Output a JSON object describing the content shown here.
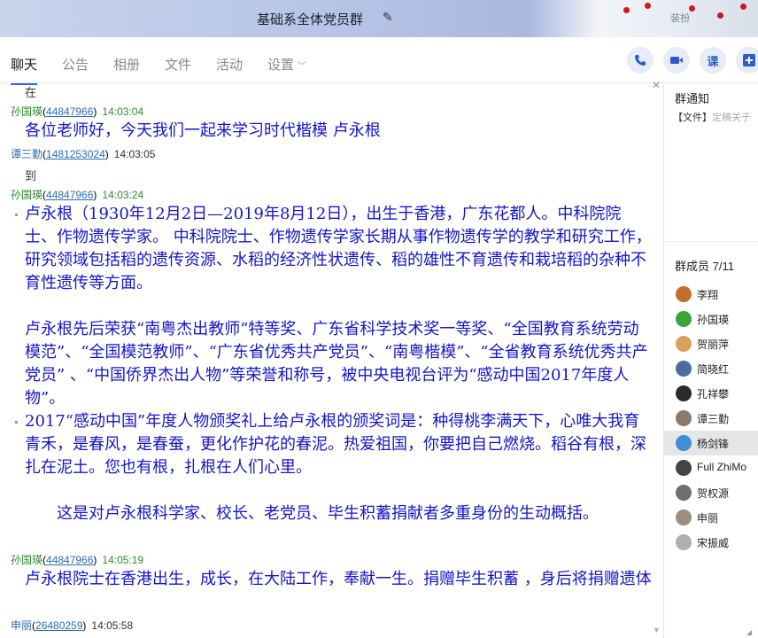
{
  "window": {
    "title": "基础系全体党员群",
    "settings_hint": "装扮"
  },
  "tabs": [
    "聊天",
    "公告",
    "相册",
    "文件",
    "活动",
    "设置"
  ],
  "toolbar": {
    "phone_icon": "phone-icon",
    "video_icon": "video-icon",
    "class_label": "课",
    "more_icon": "plus-icon"
  },
  "chat": {
    "messages": [
      {
        "text": "在"
      },
      {
        "name": "孙国瑛",
        "id": "44847966",
        "time": "14:03:04"
      },
      {
        "text": "各位老师好，今天我们一起来学习时代楷模 卢永根"
      },
      {
        "name": "谭三勤",
        "id": "1481253024",
        "time": "14:03:05"
      },
      {
        "text": "到"
      },
      {
        "name": "孙国瑛",
        "id": "44847966",
        "time": "14:03:24"
      },
      {
        "text": "卢永根（1930年12月2日—2019年8月12日），出生于香港，广东花都人。中科院院士、作物遗传学家。 中科院院士、作物遗传学家长期从事作物遗传学的教学和研究工作，研究领域包括稻的遗传资源、水稻的经济性状遗传、稻的雄性不育遗传和栽培稻的杂种不育性遗传等方面。"
      },
      {
        "text": "卢永根先后荣获“南粤杰出教师”特等奖、广东省科学技术奖一等奖、“全国教育系统劳动模范”、“全国模范教师”、“广东省优秀共产党员”、“南粤楷模”、“全省教育系统优秀共产党员” 、“中国侨界杰出人物”等荣誉和称号，被中央电视台评为“感动中国2017年度人物”。"
      },
      {
        "text": "2017“感动中国”年度人物颁奖礼上给卢永根的颁奖词是：种得桃李满天下，心唯大我育青禾，是春风，是春蚕，更化作护花的春泥。热爱祖国，你要把自己燃烧。稻谷有根，深扎在泥土。您也有根，扎根在人们心里。"
      },
      {
        "text": "这是对卢永根科学家、校长、老党员、毕生积蓄捐献者多重身份的生动概括。"
      },
      {
        "name": "孙国瑛",
        "id": "44847966",
        "time": "14:05:19"
      },
      {
        "text": "卢永根院士在香港出生，成长，在大陆工作，奉献一生。捐赠毕生积蓄 ，身后将捐赠遗体"
      },
      {
        "name": "申丽",
        "id": "26480259",
        "time": "14:05:58"
      }
    ]
  },
  "sidebar": {
    "notice_title": "群通知",
    "notice_tag": "【文件】",
    "notice_text": "定稿关于",
    "members_title": "群成员 7/11",
    "members": [
      {
        "name": "李翔",
        "color": "#c0702c"
      },
      {
        "name": "孙国瑛",
        "color": "#3aa63a"
      },
      {
        "name": "贺丽萍",
        "color": "#d9a25a"
      },
      {
        "name": "简晓红",
        "color": "#4a6f9c"
      },
      {
        "name": "孔祥攀",
        "color": "#2b2b2b"
      },
      {
        "name": "谭三勤",
        "color": "#8a7a6a"
      },
      {
        "name": "杨剑锋",
        "color": "#3d8fd6"
      },
      {
        "name": "Full ZhiMo",
        "color": "#444444"
      },
      {
        "name": "贺权源",
        "color": "#6f6f6f"
      },
      {
        "name": "申丽",
        "color": "#9a8f7a"
      },
      {
        "name": "宋振威",
        "color": "#b0b0b0"
      }
    ]
  }
}
